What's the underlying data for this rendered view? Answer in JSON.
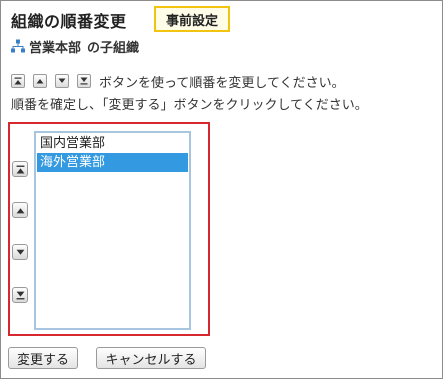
{
  "header": {
    "title": "組織の順番変更",
    "mode_badge": "事前設定"
  },
  "breadcrumb": {
    "organization": "営業本部",
    "suffix": "の子組織"
  },
  "instructions": {
    "line1": "ボタンを使って順番を変更してください。",
    "line2": "順番を確定し、「変更する」ボタンをクリックしてください。"
  },
  "order_list": {
    "items": [
      {
        "label": "国内営業部",
        "selected": false
      },
      {
        "label": "海外営業部",
        "selected": true
      }
    ]
  },
  "order_buttons": [
    {
      "name": "move-top-button",
      "icon": "move-top-icon"
    },
    {
      "name": "move-up-button",
      "icon": "move-up-icon"
    },
    {
      "name": "move-down-button",
      "icon": "move-down-icon"
    },
    {
      "name": "move-bottom-button",
      "icon": "move-bottom-icon"
    }
  ],
  "actions": {
    "submit_label": "変更する",
    "cancel_label": "キャンセルする"
  },
  "colors": {
    "highlight_frame": "#d7282f",
    "badge_border": "#f1c40f",
    "selected_item": "#3399e0",
    "org_icon": "#3b7fc4"
  }
}
